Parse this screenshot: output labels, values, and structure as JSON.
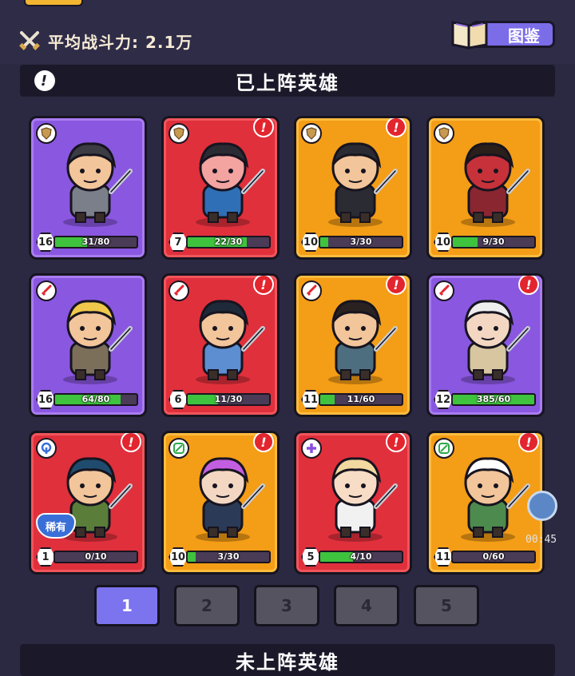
{
  "header": {
    "power_label": "平均战斗力: 2.1万",
    "codex_label": "图鉴"
  },
  "deployed": {
    "title": "已上阵英雄"
  },
  "undeployed": {
    "title": "未上阵英雄"
  },
  "colors": {
    "purple": "#8a57e0",
    "red": "#e0303c",
    "orange": "#f49d16",
    "progress": "#3fc23e",
    "page_active": "#7c73ef"
  },
  "heroes": [
    {
      "level": "16",
      "progress": "31/80",
      "fill": 0.39,
      "color": "purple",
      "role": "shield-icon",
      "alert": false,
      "badge": ""
    },
    {
      "level": "7",
      "progress": "22/30",
      "fill": 0.73,
      "color": "red",
      "role": "shield-icon",
      "alert": true,
      "badge": ""
    },
    {
      "level": "10",
      "progress": "3/30",
      "fill": 0.1,
      "color": "orange",
      "role": "shield-icon",
      "alert": true,
      "badge": ""
    },
    {
      "level": "10",
      "progress": "9/30",
      "fill": 0.3,
      "color": "orange",
      "role": "shield-icon",
      "alert": false,
      "badge": ""
    },
    {
      "level": "16",
      "progress": "64/80",
      "fill": 0.8,
      "color": "purple",
      "role": "sword-icon",
      "alert": false,
      "badge": ""
    },
    {
      "level": "6",
      "progress": "11/30",
      "fill": 0.37,
      "color": "red",
      "role": "sword-icon",
      "alert": true,
      "badge": ""
    },
    {
      "level": "11",
      "progress": "11/60",
      "fill": 0.18,
      "color": "orange",
      "role": "sword-icon",
      "alert": true,
      "badge": ""
    },
    {
      "level": "12",
      "progress": "385/60",
      "fill": 1.0,
      "color": "purple",
      "role": "sword-icon",
      "alert": true,
      "badge": ""
    },
    {
      "level": "1",
      "progress": "0/10",
      "fill": 0.0,
      "color": "red",
      "role": "magic-icon",
      "alert": true,
      "badge": "稀有"
    },
    {
      "level": "10",
      "progress": "3/30",
      "fill": 0.1,
      "color": "orange",
      "role": "bow-icon",
      "alert": true,
      "badge": ""
    },
    {
      "level": "5",
      "progress": "4/10",
      "fill": 0.4,
      "color": "red",
      "role": "healer-icon",
      "alert": true,
      "badge": ""
    },
    {
      "level": "11",
      "progress": "0/60",
      "fill": 0.0,
      "color": "orange",
      "role": "bow-icon",
      "alert": true,
      "badge": ""
    }
  ],
  "pages": [
    "1",
    "2",
    "3",
    "4",
    "5"
  ],
  "active_page": "1",
  "timer": "00:45"
}
